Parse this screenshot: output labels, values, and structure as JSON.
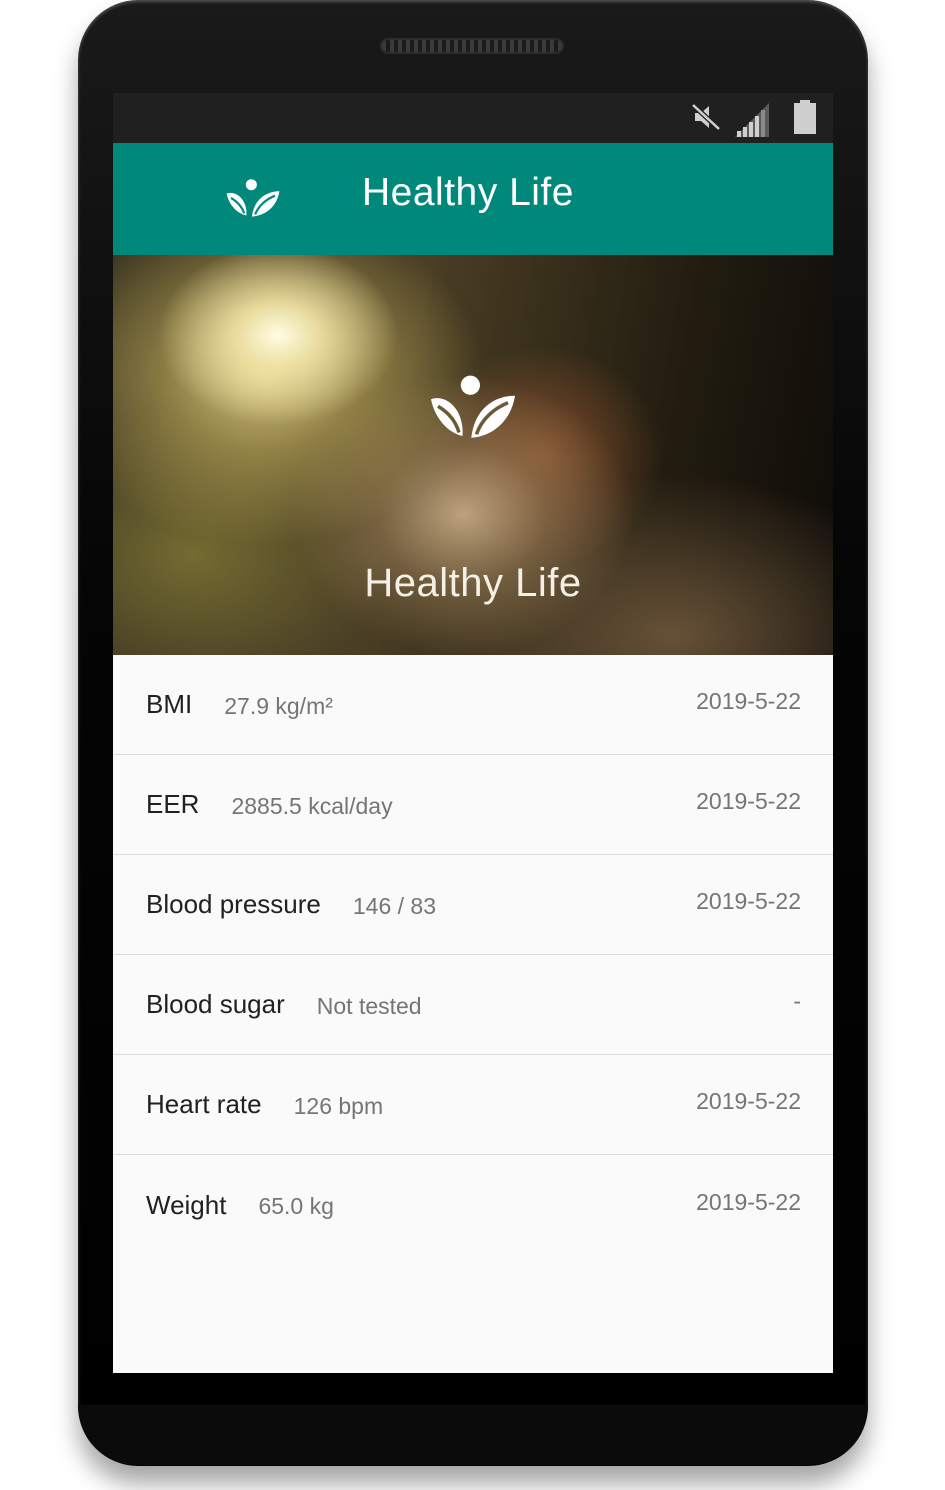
{
  "app": {
    "title": "Healthy Life",
    "hero_title": "Healthy Life"
  },
  "status_bar": {
    "icons": [
      "mute-icon",
      "signal-icon",
      "battery-icon"
    ]
  },
  "metrics": [
    {
      "name": "BMI",
      "value": "27.9 kg/m²",
      "date": "2019-5-22"
    },
    {
      "name": "EER",
      "value": "2885.5 kcal/day",
      "date": "2019-5-22"
    },
    {
      "name": "Blood pressure",
      "value": "146 / 83",
      "date": "2019-5-22"
    },
    {
      "name": "Blood sugar",
      "value": "Not tested",
      "date": "-"
    },
    {
      "name": "Heart rate",
      "value": "126 bpm",
      "date": "2019-5-22"
    },
    {
      "name": "Weight",
      "value": "65.0 kg",
      "date": "2019-5-22"
    }
  ],
  "colors": {
    "app_bar": "#00897b",
    "status_bar": "#202020",
    "list_background": "#fafafa",
    "primary_text": "#212121",
    "secondary_text": "#757575"
  }
}
